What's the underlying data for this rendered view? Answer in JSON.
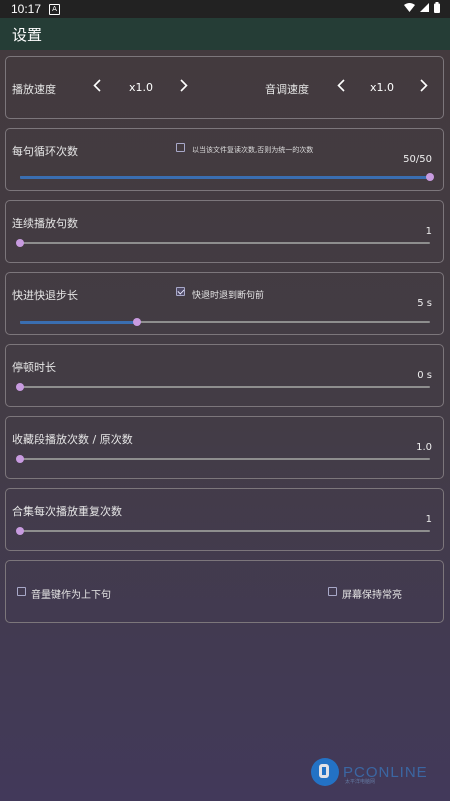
{
  "status": {
    "time": "10:17",
    "notif_icon": "A"
  },
  "appbar": {
    "title": "设置"
  },
  "speed": {
    "play_label": "播放速度",
    "play_value": "x1.0",
    "pitch_label": "音调速度",
    "pitch_value": "x1.0"
  },
  "loop": {
    "label": "每句循环次数",
    "checkbox_label": "以当该文件复读次数,否则为统一的次数",
    "checkbox_checked": false,
    "value_text": "50/50",
    "fraction": 1.0
  },
  "continuous": {
    "label": "连续播放句数",
    "value_text": "1",
    "fraction": 0.0
  },
  "seek": {
    "label": "快进快退步长",
    "checkbox_label": "快退时退到断句前",
    "checkbox_checked": true,
    "value_text": "5 s",
    "fraction": 0.285
  },
  "pause": {
    "label": "停顿时长",
    "value_text": "0 s",
    "fraction": 0.0
  },
  "fav": {
    "label": "收藏段播放次数 / 原次数",
    "value_text": "1.0",
    "fraction": 0.0
  },
  "collection": {
    "label": "合集每次播放重复次数",
    "value_text": "1",
    "fraction": 0.0
  },
  "options": {
    "volume_key_label": "音量键作为上下句",
    "volume_key_checked": false,
    "screen_on_label": "屏幕保持常亮",
    "screen_on_checked": false
  },
  "watermark": {
    "text": "PCONLINE",
    "sub": "太平洋电脑网"
  }
}
